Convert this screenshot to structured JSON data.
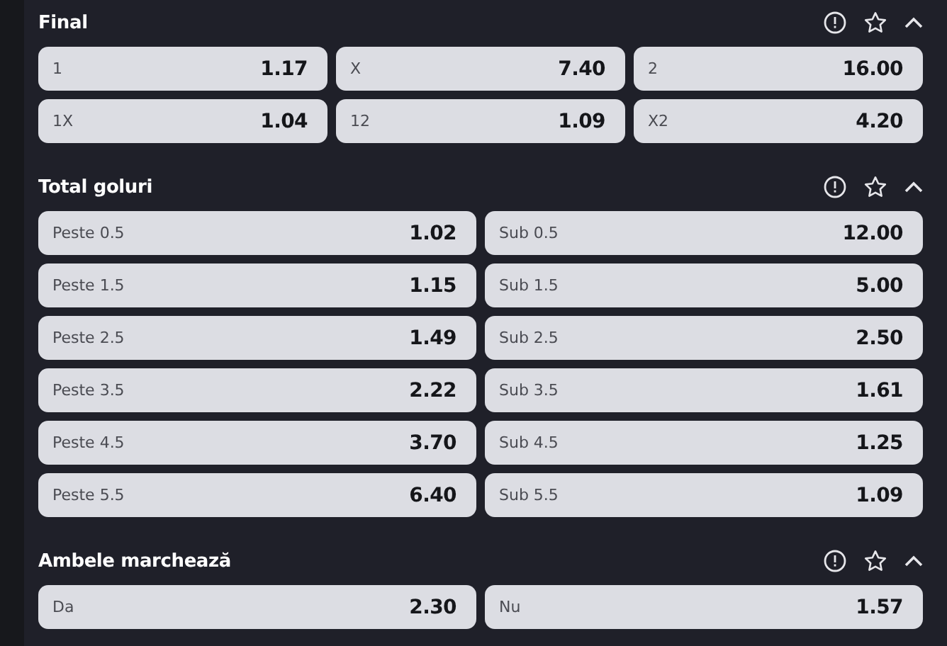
{
  "markets": [
    {
      "title": "Final",
      "kind": "triple",
      "options": [
        {
          "label": "1",
          "odds": "1.17"
        },
        {
          "label": "X",
          "odds": "7.40"
        },
        {
          "label": "2",
          "odds": "16.00"
        },
        {
          "label": "1X",
          "odds": "1.04"
        },
        {
          "label": "12",
          "odds": "1.09"
        },
        {
          "label": "X2",
          "odds": "4.20"
        }
      ]
    },
    {
      "title": "Total goluri",
      "kind": "pair",
      "options": [
        {
          "label": "Peste 0.5",
          "odds": "1.02"
        },
        {
          "label": "Sub 0.5",
          "odds": "12.00"
        },
        {
          "label": "Peste 1.5",
          "odds": "1.15"
        },
        {
          "label": "Sub 1.5",
          "odds": "5.00"
        },
        {
          "label": "Peste 2.5",
          "odds": "1.49"
        },
        {
          "label": "Sub 2.5",
          "odds": "2.50"
        },
        {
          "label": "Peste 3.5",
          "odds": "2.22"
        },
        {
          "label": "Sub 3.5",
          "odds": "1.61"
        },
        {
          "label": "Peste 4.5",
          "odds": "3.70"
        },
        {
          "label": "Sub 4.5",
          "odds": "1.25"
        },
        {
          "label": "Peste 5.5",
          "odds": "6.40"
        },
        {
          "label": "Sub 5.5",
          "odds": "1.09"
        }
      ]
    },
    {
      "title": "Ambele marchează",
      "kind": "pair",
      "options": [
        {
          "label": "Da",
          "odds": "2.30"
        },
        {
          "label": "Nu",
          "odds": "1.57"
        }
      ]
    }
  ]
}
